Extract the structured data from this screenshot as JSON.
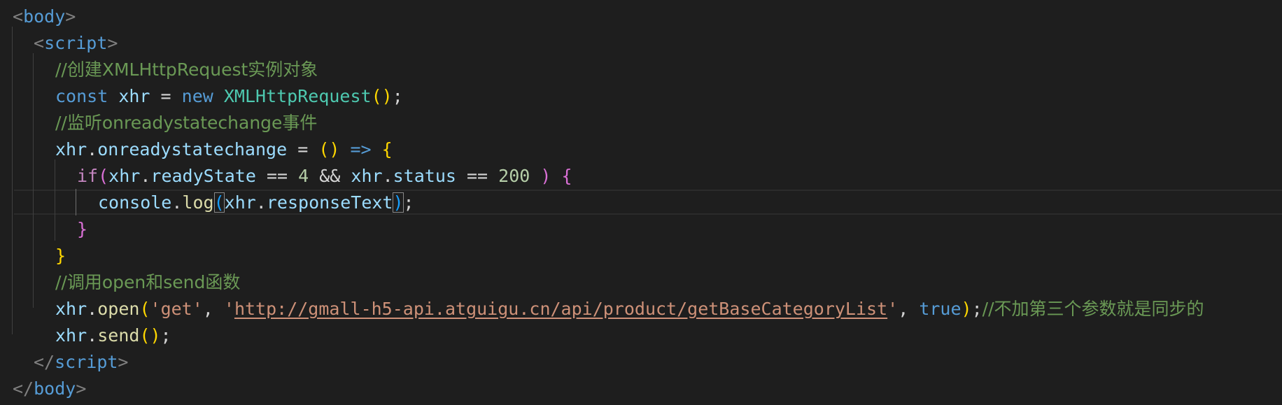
{
  "code": {
    "l1_lt": "<",
    "l1_tag": "body",
    "l1_gt": ">",
    "l2_lt": "<",
    "l2_tag": "script",
    "l2_gt": ">",
    "l3_comment": "//创建XMLHttpRequest实例对象",
    "l4_const": "const",
    "l4_xhr": "xhr",
    "l4_eq": " = ",
    "l4_new": "new",
    "l4_cls": "XMLHttpRequest",
    "l4_paren": "()",
    "l4_semi": ";",
    "l5_comment": "//监听onreadystatechange事件",
    "l6_xhr": "xhr",
    "l6_dot": ".",
    "l6_prop": "onreadystatechange",
    "l6_eq": " = ",
    "l6_paren": "()",
    "l6_arrow": "=>",
    "l6_brace": "{",
    "l7_if": "if",
    "l7_lp": "(",
    "l7_xhr": "xhr",
    "l7_dot": ".",
    "l7_prop": "readyState",
    "l7_eqeq": " == ",
    "l7_num1": "4",
    "l7_and": " && ",
    "l7_xhr2": "xhr",
    "l7_dot2": ".",
    "l7_prop2": "status",
    "l7_eqeq2": " == ",
    "l7_num2": "200",
    "l7_rp": ")",
    "l7_brace": "{",
    "l8_console": "console",
    "l8_dot": ".",
    "l8_log": "log",
    "l8_lp": "(",
    "l8_xhr": "xhr",
    "l8_dot2": ".",
    "l8_prop": "responseText",
    "l8_rp": ")",
    "l8_semi": ";",
    "l9_brace": "}",
    "l10_brace": "}",
    "l11_comment": "//调用open和send函数",
    "l12_xhr": "xhr",
    "l12_dot": ".",
    "l12_open": "open",
    "l12_lp": "(",
    "l12_q1": "'",
    "l12_get": "get",
    "l12_q2": "'",
    "l12_comma": ", ",
    "l12_q3": "'",
    "l12_url": "http://gmall-h5-api.atguigu.cn/api/product/getBaseCategoryList",
    "l12_q4": "'",
    "l12_comma2": ", ",
    "l12_true": "true",
    "l12_rp": ")",
    "l12_semi": ";",
    "l12_comment": "//不加第三个参数就是同步的",
    "l13_xhr": "xhr",
    "l13_dot": ".",
    "l13_send": "send",
    "l13_paren": "()",
    "l13_semi": ";",
    "l14_lt": "</",
    "l14_tag": "script",
    "l14_gt": ">",
    "l15_lt": "</",
    "l15_tag": "body",
    "l15_gt": ">"
  }
}
